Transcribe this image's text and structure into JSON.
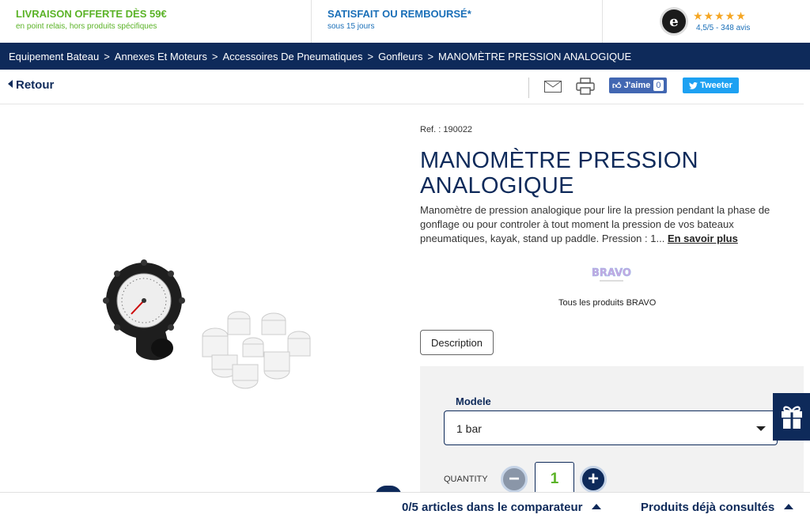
{
  "topbar": {
    "shipping": {
      "title": "LIVRAISON OFFERTE DÈS 59€",
      "sub": "en point relais, hors produits spécifiques"
    },
    "guarantee": {
      "title": "SATISFAIT OU REMBOURSÉ*",
      "sub": "sous 15 jours"
    },
    "rating": {
      "stars": "★★★★★",
      "text": "4,5/5 - 348 avis",
      "logo": "e"
    }
  },
  "breadcrumb": {
    "items": [
      "Equipement Bateau",
      "Annexes Et Moteurs",
      "Accessoires De Pneumatiques",
      "Gonfleurs",
      "MANOMÈTRE PRESSION ANALOGIQUE"
    ],
    "separator": ">"
  },
  "actions": {
    "back": "Retour",
    "fb_label": "J'aime",
    "fb_count": "0",
    "tweet_label": "Tweeter"
  },
  "product": {
    "ref": "Ref. : 190022",
    "title": "MANOMÈTRE PRESSION ANALOGIQUE",
    "description": "Manomètre de pression analogique pour lire la pression pendant la phase de gonflage ou pour controler à tout moment la pression de vos bateaux pneumatiques, kayak, stand up paddle. Pression : 1...",
    "more_link": "En savoir plus",
    "brand_logo_text": "BRAVO",
    "brand_link": "Tous les produits BRAVO",
    "description_button": "Description"
  },
  "options": {
    "model_label": "Modele",
    "model_value": "1 bar",
    "quantity_label": "QUANTITY",
    "quantity_value": "1"
  },
  "bottombar": {
    "compare": "0/5 articles dans le comparateur",
    "seen": "Produits déjà consultés"
  },
  "colors": {
    "navy": "#0e2a5a",
    "green": "#5bb327",
    "blue": "#1a6fb8",
    "facebook": "#4267b2",
    "twitter": "#1da1f2"
  }
}
